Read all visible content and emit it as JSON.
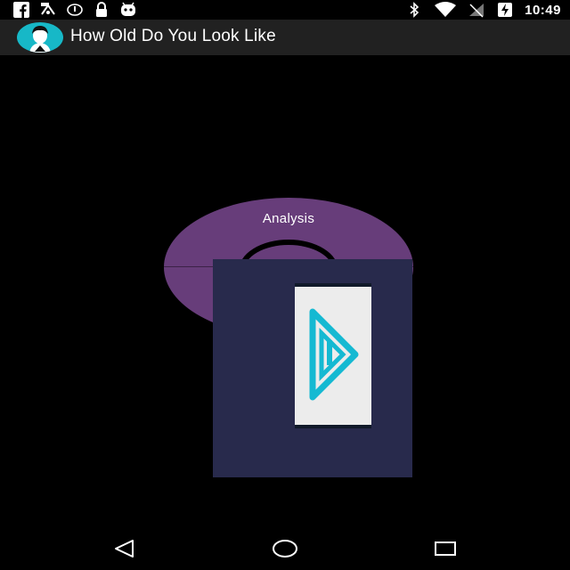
{
  "status_bar": {
    "left_icons": [
      "facebook-icon",
      "fake-gps-icon",
      "sync-icon",
      "lock-icon",
      "android-icon"
    ],
    "right_icons": [
      "bluetooth-icon",
      "wifi-icon",
      "no-signal-icon",
      "battery-charging-icon"
    ],
    "time": "10:49"
  },
  "app_bar": {
    "title": "How Old Do You Look Like",
    "logo_icon": "face-avatar-icon"
  },
  "main": {
    "analysis_label": "Analysis",
    "disc_color": "#673d7a",
    "overlay_color": "#282a4c",
    "tile_icon": "cyan-triangle-app-icon"
  },
  "nav_bar": {
    "buttons": [
      "back-icon",
      "home-icon",
      "recents-icon"
    ]
  }
}
